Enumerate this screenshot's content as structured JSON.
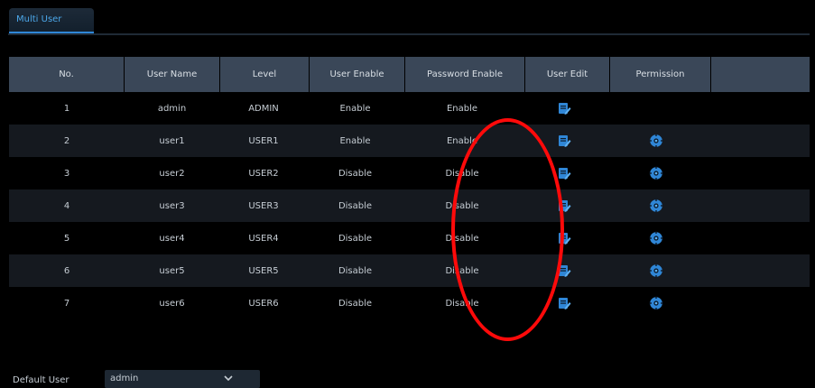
{
  "tab": {
    "label": "Multi User"
  },
  "table": {
    "headers": [
      "No.",
      "User Name",
      "Level",
      "User Enable",
      "Password Enable",
      "User Edit",
      "Permission"
    ],
    "rows": [
      {
        "no": "1",
        "name": "admin",
        "level": "ADMIN",
        "user_enable": "Enable",
        "password_enable": "Enable",
        "permission": false
      },
      {
        "no": "2",
        "name": "user1",
        "level": "USER1",
        "user_enable": "Enable",
        "password_enable": "Enable",
        "permission": true
      },
      {
        "no": "3",
        "name": "user2",
        "level": "USER2",
        "user_enable": "Disable",
        "password_enable": "Disable",
        "permission": true
      },
      {
        "no": "4",
        "name": "user3",
        "level": "USER3",
        "user_enable": "Disable",
        "password_enable": "Disable",
        "permission": true
      },
      {
        "no": "5",
        "name": "user4",
        "level": "USER4",
        "user_enable": "Disable",
        "password_enable": "Disable",
        "permission": true
      },
      {
        "no": "6",
        "name": "user5",
        "level": "USER5",
        "user_enable": "Disable",
        "password_enable": "Disable",
        "permission": true
      },
      {
        "no": "7",
        "name": "user6",
        "level": "USER6",
        "user_enable": "Disable",
        "password_enable": "Disable",
        "permission": true
      }
    ]
  },
  "default_user": {
    "label": "Default User",
    "value": "admin"
  },
  "icons": {
    "edit": "edit-icon",
    "permission": "gear-icon",
    "dropdown": "chevron-down-icon"
  },
  "colors": {
    "accent": "#2f86d6",
    "highlight": "#ff0a0a",
    "header_bg": "#3a4758",
    "alt_row_bg": "#15191f"
  }
}
